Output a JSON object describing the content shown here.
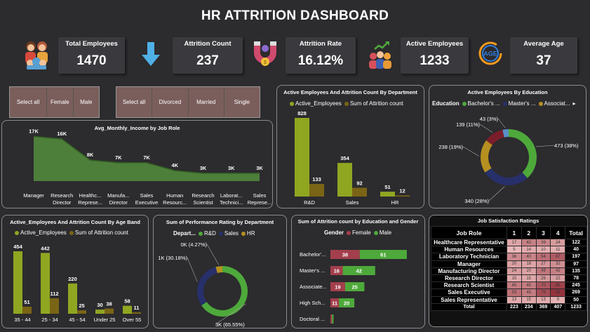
{
  "title": "HR ATTRITION DASHBOARD",
  "kpis": [
    {
      "label": "Total Employees",
      "value": "1470"
    },
    {
      "label": "Attrition Count",
      "value": "237"
    },
    {
      "label": "Attrition Rate",
      "value": "16.12%"
    },
    {
      "label": "Active Employees",
      "value": "1233"
    },
    {
      "label": "Average Age",
      "value": "37"
    }
  ],
  "age_icon_text": "AGE",
  "gender_slicer": [
    "Select all",
    "Female",
    "Male"
  ],
  "marital_slicer": [
    "Select all",
    "Divorced",
    "Married",
    "Single"
  ],
  "income_chart": {
    "title": "Avg_Monthly_Income by Job Role",
    "chart_data": {
      "type": "area",
      "categories": [
        "Manager",
        "Research Director",
        "Healthc... Represe...",
        "Manufa... Director",
        "Sales Executive",
        "Human Resourc...",
        "Research Scientist",
        "Laborat... Technici...",
        "Sales Represe..."
      ],
      "labels": [
        "17K",
        "16K",
        "8K",
        "7K",
        "7K",
        "4K",
        "3K",
        "3K",
        "3K"
      ],
      "values": [
        17,
        16,
        8,
        7,
        7,
        4,
        3,
        3,
        3
      ],
      "color": "#4d7e3a"
    }
  },
  "dept_chart": {
    "title": "Active Employees And Attrition Count By Department",
    "legend": [
      "Active_Employees",
      "Sum of Attrition count"
    ],
    "colors": [
      "#8fa621",
      "#7a6415"
    ],
    "chart_data": {
      "type": "bar",
      "categories": [
        "R&D",
        "Sales",
        "HR"
      ],
      "series": [
        {
          "name": "Active_Employees",
          "values": [
            828,
            354,
            51
          ]
        },
        {
          "name": "Sum of Attrition count",
          "values": [
            133,
            92,
            12
          ]
        }
      ]
    }
  },
  "edu_chart": {
    "title": "Active Employees By Education",
    "legend_title": "Education",
    "legend": [
      "Bachelor's ...",
      "Master's ...",
      "Associat..."
    ],
    "chart_data": {
      "type": "pie",
      "categories": [
        "Bachelor's Degree",
        "Master's Degree",
        "Associates Degree",
        "High School",
        "Doctoral Degree"
      ],
      "values": [
        473,
        340,
        238,
        139,
        43
      ],
      "labels": [
        "473 (38%)",
        "340 (28%)",
        "238 (19%)",
        "139 (11%)",
        "43 (3%)"
      ],
      "colors": [
        "#4ea93b",
        "#27306a",
        "#b59020",
        "#7a1e2a",
        "#5b8fc8"
      ]
    }
  },
  "age_chart": {
    "title": "Active_Employees And Attrition Count By Age Band",
    "legend": [
      "Active_Employees",
      "Sum of Attrition count"
    ],
    "colors": [
      "#8fa621",
      "#7a6415"
    ],
    "chart_data": {
      "type": "bar",
      "categories": [
        "35 - 44",
        "25 - 34",
        "45 - 54",
        "Under 25",
        "Over 55"
      ],
      "series": [
        {
          "name": "Active_Employees",
          "values": [
            454,
            442,
            220,
            30,
            58
          ]
        },
        {
          "name": "Sum of Attrition count",
          "values": [
            51,
            112,
            25,
            38,
            11
          ]
        }
      ]
    }
  },
  "perf_chart": {
    "title": "Sum of Performance Rating by Department",
    "legend_title": "Depart...",
    "legend": [
      "R&D",
      "Sales",
      "HR"
    ],
    "chart_data": {
      "type": "pie",
      "categories": [
        "R&D",
        "Sales",
        "HR"
      ],
      "values": [
        65.55,
        30.18,
        4.27
      ],
      "labels": [
        "3K (65.55%)",
        "1K (30.18%)",
        "0K (4.27%)"
      ],
      "colors": [
        "#4ea93b",
        "#27306a",
        "#b59020"
      ]
    }
  },
  "edu_gender_chart": {
    "title": "Sum of Attrition count by Education and Gender",
    "legend_title": "Gender",
    "legend": [
      "Female",
      "Male"
    ],
    "colors": [
      "#a33f4c",
      "#4ea93b"
    ],
    "chart_data": {
      "type": "bar",
      "orientation": "horizontal",
      "stacked": true,
      "categories": [
        "Bachelor'...",
        "Master's ...",
        "Associate...",
        "High Sch...",
        "Doctoral ..."
      ],
      "series": [
        {
          "name": "Female",
          "values": [
            38,
            16,
            19,
            11,
            2
          ]
        },
        {
          "name": "Male",
          "values": [
            61,
            42,
            25,
            20,
            2
          ]
        }
      ],
      "labels": {
        "Female": [
          "38",
          "16",
          "19",
          "11",
          ""
        ],
        "Male": [
          "61",
          "42",
          "25",
          "20",
          ""
        ]
      }
    }
  },
  "job_sat": {
    "title": "Job Satisfaction Ratings",
    "headers": [
      "Job Role",
      "1",
      "2",
      "3",
      "4",
      "Total"
    ],
    "rows": [
      [
        "Healthcare Representative",
        "17",
        "42",
        "39",
        "24",
        "122"
      ],
      [
        "Human Resources",
        "5",
        "14",
        "10",
        "11",
        "40"
      ],
      [
        "Laboratory Technician",
        "36",
        "40",
        "54",
        "67",
        "197"
      ],
      [
        "Manager",
        "20",
        "18",
        "27",
        "32",
        "97"
      ],
      [
        "Manufacturing Director",
        "24",
        "20",
        "49",
        "42",
        "135"
      ],
      [
        "Research Director",
        "15",
        "15",
        "26",
        "22",
        "78"
      ],
      [
        "Research Scientist",
        "45",
        "45",
        "70",
        "85",
        "245"
      ],
      [
        "Sales Executive",
        "53",
        "45",
        "76",
        "95",
        "269"
      ],
      [
        "Sales Representative",
        "13",
        "15",
        "13",
        "9",
        "50"
      ]
    ],
    "total": [
      "Total",
      "223",
      "234",
      "369",
      "407",
      "1233"
    ]
  }
}
